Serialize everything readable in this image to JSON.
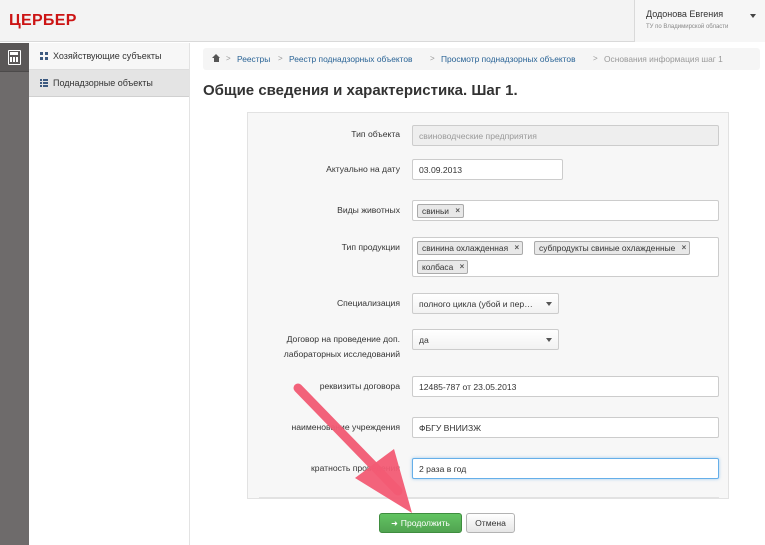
{
  "app": {
    "title": "ЦЕРБЕР",
    "user_name": "Додонова Евгения",
    "user_org": "ТУ по Владимирской области"
  },
  "sidebar": {
    "items": [
      {
        "label": "Хозяйствующие субъекты",
        "icon": "grid-icon"
      },
      {
        "label": "Поднадзорные объекты",
        "icon": "list-icon"
      }
    ]
  },
  "breadcrumb": {
    "items": [
      "Реестры",
      "Реестр поднадзорных объектов",
      "Просмотр поднадзорных объектов",
      "Основания информация шаг 1"
    ]
  },
  "page": {
    "title": "Общие сведения и характеристика. Шаг 1."
  },
  "form": {
    "object_type": {
      "label": "Тип объекта",
      "value": "свиноводческие предприятия"
    },
    "actual_date": {
      "label": "Актуально на дату",
      "value": "03.09.2013"
    },
    "animal_types": {
      "label": "Виды животных",
      "tags": [
        "свиньи"
      ]
    },
    "product_types": {
      "label": "Тип продукции",
      "tags": [
        "свинина охлажденная",
        "субпродукты свиные охлажденные",
        "колбаса"
      ]
    },
    "specialization": {
      "label": "Специализация",
      "value": "полного цикла (убой и пер…"
    },
    "contract": {
      "label_line1": "Договор на проведение доп.",
      "label_line2": "лабораторных исследований",
      "value": "да"
    },
    "contract_details": {
      "label": "реквизиты договора",
      "value": "12485-787 от 23.05.2013"
    },
    "institution": {
      "label": "наименование учреждения",
      "value": "ФБГУ ВНИИЗЖ"
    },
    "frequency": {
      "label": "кратность проведения",
      "value": "2 раза в год"
    }
  },
  "buttons": {
    "continue": "Продолжить",
    "cancel": "Отмена"
  },
  "colors": {
    "brand": "#cc1414",
    "link": "#2a6496",
    "primary_button": "#51a351",
    "annotation_arrow": "#f25b74"
  }
}
